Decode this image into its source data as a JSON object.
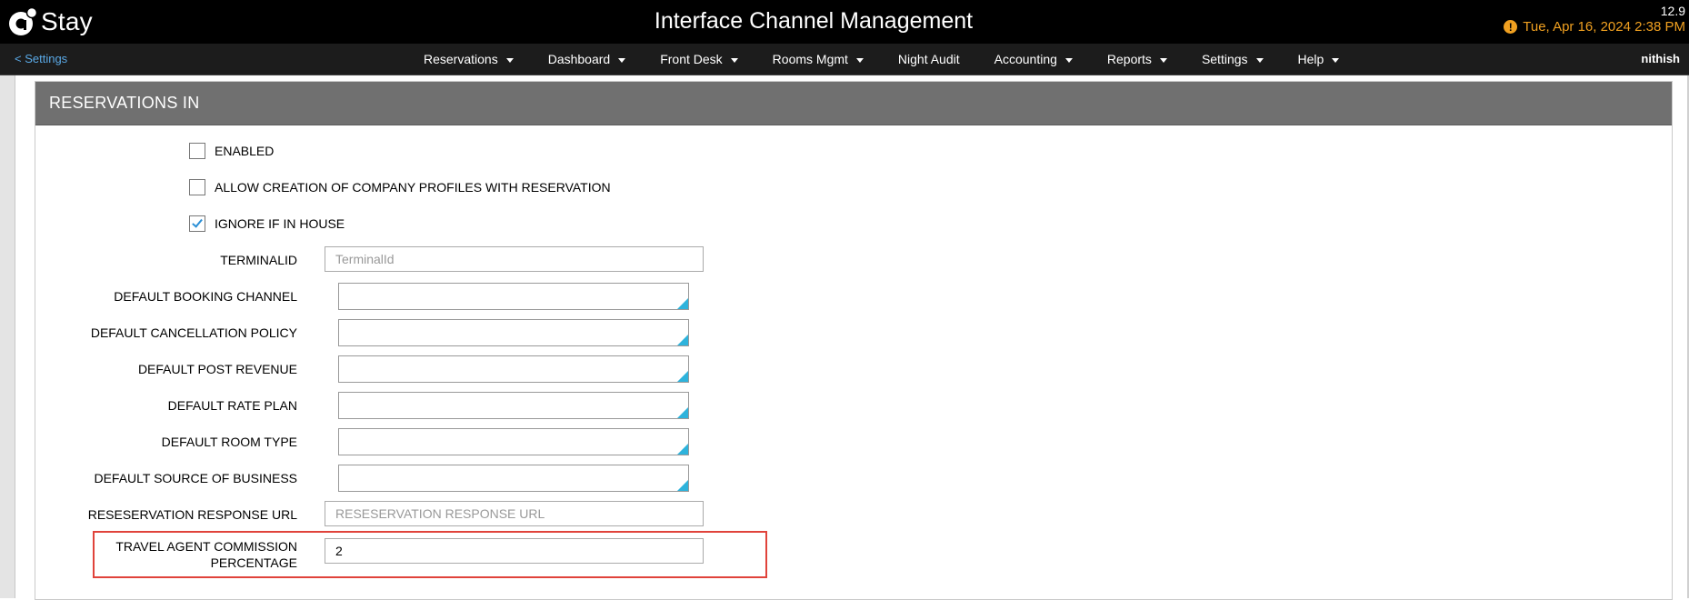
{
  "app": {
    "logo_text": "Stay",
    "title": "Interface Channel Management",
    "version": "12.9",
    "datetime": "Tue, Apr 16, 2024 2:38 PM",
    "warning_glyph": "!"
  },
  "nav": {
    "back_label": "< Settings",
    "items": [
      {
        "label": "Reservations",
        "dropdown": true
      },
      {
        "label": "Dashboard",
        "dropdown": true
      },
      {
        "label": "Front Desk",
        "dropdown": true
      },
      {
        "label": "Rooms Mgmt",
        "dropdown": true
      },
      {
        "label": "Night Audit",
        "dropdown": false
      },
      {
        "label": "Accounting",
        "dropdown": true
      },
      {
        "label": "Reports",
        "dropdown": true
      },
      {
        "label": "Settings",
        "dropdown": true
      },
      {
        "label": "Help",
        "dropdown": true
      }
    ],
    "user": "nithish"
  },
  "panel": {
    "title": "RESERVATIONS IN",
    "checkboxes": [
      {
        "label": "ENABLED",
        "checked": false
      },
      {
        "label": "ALLOW CREATION OF COMPANY PROFILES WITH RESERVATION",
        "checked": false
      },
      {
        "label": "IGNORE IF IN HOUSE",
        "checked": true
      }
    ],
    "fields": {
      "terminal_id": {
        "label": "TERMINALID",
        "value": "",
        "placeholder": "TerminalId"
      },
      "booking_channel": {
        "label": "DEFAULT BOOKING CHANNEL",
        "value": ""
      },
      "cancellation_policy": {
        "label": "DEFAULT CANCELLATION POLICY",
        "value": ""
      },
      "post_revenue": {
        "label": "DEFAULT POST REVENUE",
        "value": ""
      },
      "rate_plan": {
        "label": "DEFAULT RATE PLAN",
        "value": ""
      },
      "room_type": {
        "label": "DEFAULT ROOM TYPE",
        "value": ""
      },
      "source_of_business": {
        "label": "DEFAULT SOURCE OF BUSINESS",
        "value": ""
      },
      "response_url": {
        "label": "RESESERVATION RESPONSE URL",
        "value": "",
        "placeholder": "RESESERVATION RESPONSE URL"
      },
      "ta_commission": {
        "label_line1": "TRAVEL AGENT COMMISSION",
        "label_line2": "PERCENTAGE",
        "value": "2"
      }
    }
  },
  "colors": {
    "header_bg": "#000000",
    "accent_link": "#5aa9e6",
    "datetime": "#f0a020",
    "panel_header": "#707070",
    "select_corner": "#2eb3dc",
    "highlight": "#e0433b"
  }
}
